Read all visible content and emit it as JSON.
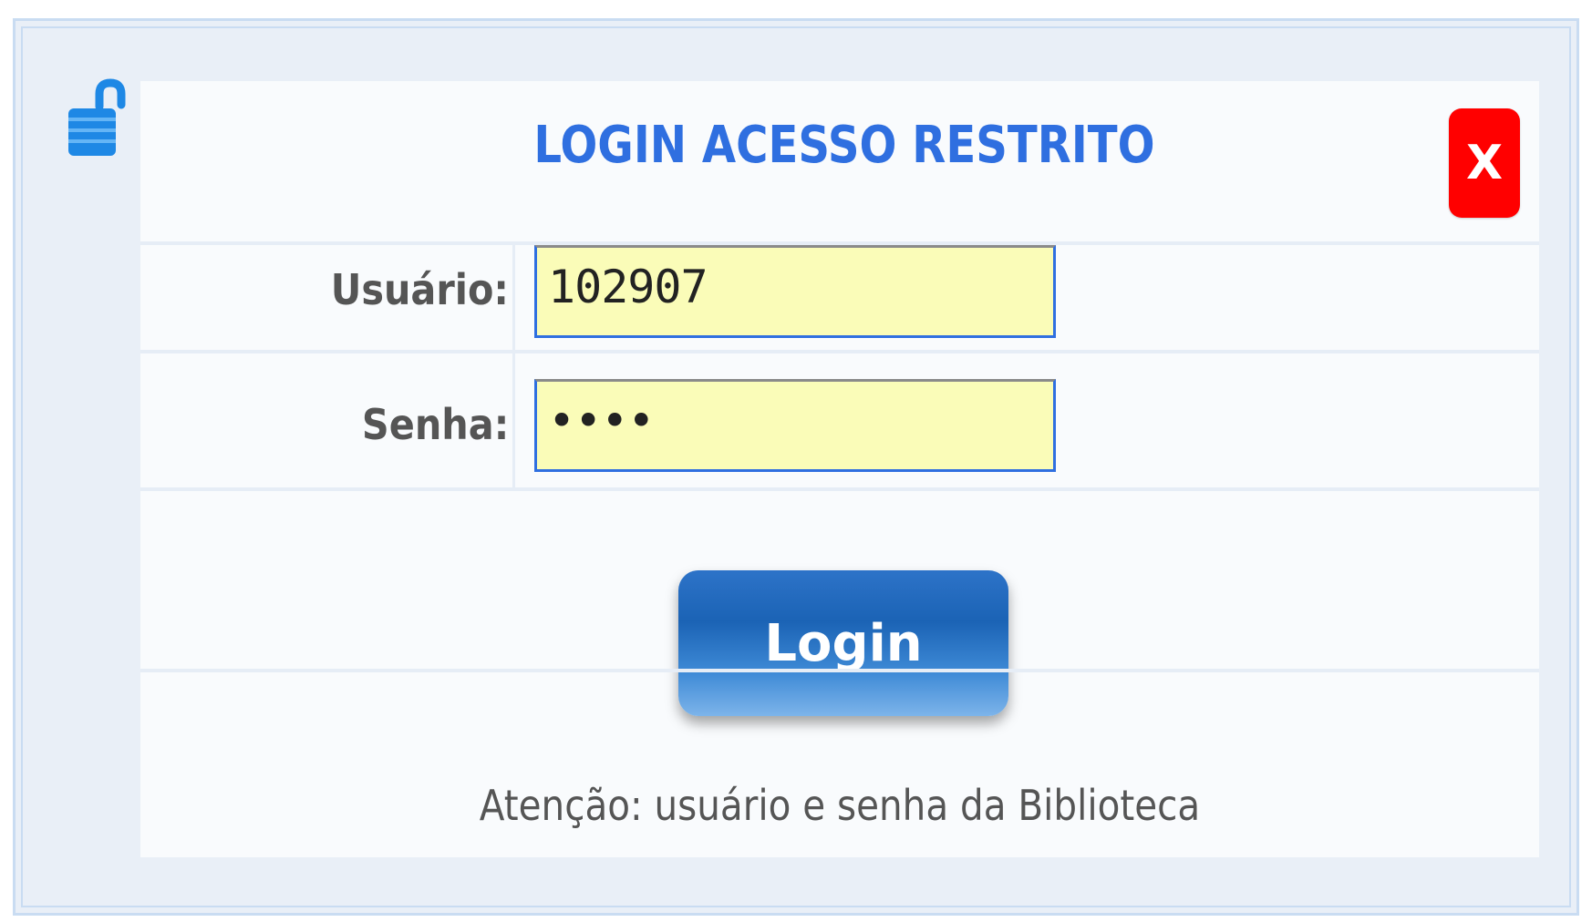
{
  "dialog": {
    "title": "LOGIN ACESSO RESTRITO",
    "close_label": "X",
    "lock_icon": "unlocked-padlock-icon",
    "username": {
      "label": "Usuário:",
      "value": "102907"
    },
    "password": {
      "label": "Senha:",
      "value": "••••"
    },
    "login_label": "Login",
    "notice": "Atenção: usuário e senha da Biblioteca"
  },
  "colors": {
    "accent": "#2f6fe0",
    "close_button": "#ff0000",
    "input_background": "#fafcb8",
    "button_blue": "#1b63b5"
  }
}
